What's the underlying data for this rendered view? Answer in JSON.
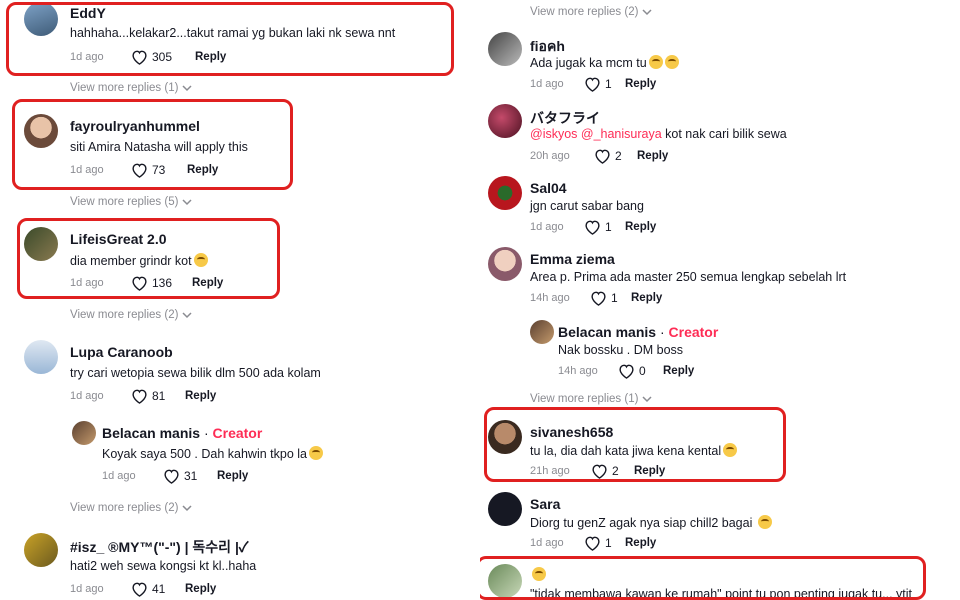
{
  "ui": {
    "reply_label": "Reply",
    "creator_label": "Creator"
  },
  "left": {
    "top_view_more": "View more replies (1)",
    "comments": [
      {
        "user": "EddY",
        "text": "hahhaha...kelakar2...takut ramai yg bukan laki nk sewa nnt",
        "time": "1d ago",
        "likes": "305"
      },
      {
        "user": "fayroulryanhummel",
        "text": "siti Amira Natasha will apply this",
        "time": "1d ago",
        "likes": "73"
      },
      {
        "user": "LifeisGreat 2.0",
        "text": "dia member grindr kot",
        "time": "1d ago",
        "likes": "136"
      },
      {
        "user": "Lupa Caranoob",
        "text": "try cari wetopia sewa bilik dlm 500 ada kolam",
        "time": "1d ago",
        "likes": "81"
      },
      {
        "user": "Belacan manis",
        "creator": "Creator",
        "text": "Koyak saya 500 . Dah kahwin tkpo la",
        "time": "1d ago",
        "likes": "31"
      },
      {
        "user": "#isz_ ®MY™(\"-\") | 독수리 |✓",
        "text": "hati2 weh sewa kongsi kt kl..haha",
        "time": "1d ago",
        "likes": "41"
      }
    ],
    "view_more": [
      "View more replies (5)",
      "View more replies (2)",
      "View more replies (2)"
    ]
  },
  "right": {
    "top_view_more": "View more replies (2)",
    "comments": [
      {
        "user": "fiอคh",
        "text": "Ada jugak ka mcm tu",
        "time": "1d ago",
        "likes": "1"
      },
      {
        "user": "バタフライ",
        "mention": "@iskyos @_hanisuraya",
        "text": " kot nak cari bilik sewa",
        "time": "20h ago",
        "likes": "2"
      },
      {
        "user": "Sal04",
        "text": "jgn carut sabar bang",
        "time": "1d ago",
        "likes": "1"
      },
      {
        "user": "Emma ziema",
        "text": "Area p. Prima ada master 250 semua lengkap sebelah lrt",
        "time": "14h ago",
        "likes": "1"
      },
      {
        "user": "Belacan manis",
        "creator": "Creator",
        "text": "Nak bossku . DM boss",
        "time": "14h ago",
        "likes": "0"
      },
      {
        "user": "sivanesh658",
        "text": "tu la, dia dah kata jiwa kena kental",
        "time": "21h ago",
        "likes": "2"
      },
      {
        "user": "Sara",
        "text": "Diorg tu genZ agak nya siap chill2 bagai",
        "time": "1d ago",
        "likes": "1"
      },
      {
        "user": "",
        "text": "\"tidak membawa kawan ke rumah\" point tu pon penting jugak tu... ytjt"
      }
    ],
    "view_more": [
      "View more replies (1)"
    ]
  }
}
